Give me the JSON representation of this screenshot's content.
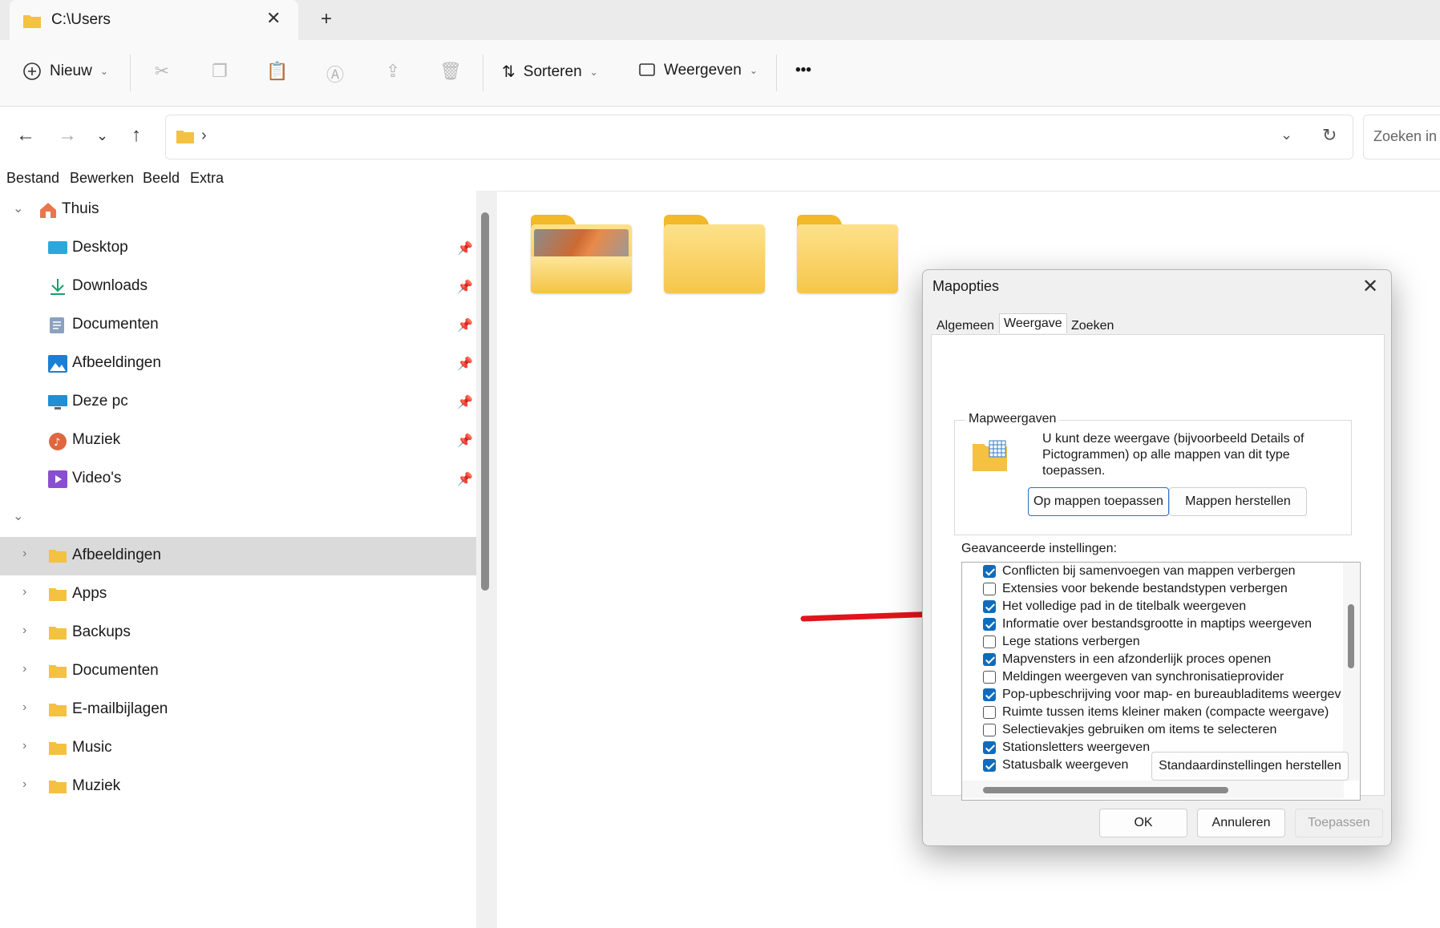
{
  "window": {
    "tab_title": "C:\\Users",
    "tab_close": "✕",
    "new_tab": "+"
  },
  "toolbar": {
    "new_label": "Nieuw",
    "sort_label": "Sorteren",
    "view_label": "Weergeven",
    "more_label": "•••"
  },
  "nav": {
    "search_placeholder": "Zoeken in A",
    "address_sep": "›"
  },
  "menu": [
    "Bestand",
    "Bewerken",
    "Beeld",
    "Extra"
  ],
  "sidebar": {
    "home": "Thuis",
    "quick": [
      "Desktop",
      "Downloads",
      "Documenten",
      "Afbeeldingen",
      "Deze pc",
      "Muziek",
      "Video's"
    ],
    "folders": [
      "Afbeeldingen",
      "Apps",
      "Backups",
      "Documenten",
      "E-mailbijlagen",
      "Music",
      "Muziek"
    ]
  },
  "dialog": {
    "title": "Mapopties",
    "tabs": [
      "Algemeen",
      "Weergave",
      "Zoeken"
    ],
    "active_tab": "Weergave",
    "group_label": "Mapweergaven",
    "group_desc": "U kunt deze weergave (bijvoorbeeld Details of Pictogrammen) op alle mappen van dit type toepassen.",
    "apply_btn": "Op mappen toepassen",
    "reset_btn": "Mappen herstellen",
    "advanced_label": "Geavanceerde instellingen:",
    "options": [
      {
        "label": "Conflicten bij samenvoegen van mappen verbergen",
        "checked": true
      },
      {
        "label": "Extensies voor bekende bestandstypen verbergen",
        "checked": false
      },
      {
        "label": "Het volledige pad in de titelbalk weergeven",
        "checked": true
      },
      {
        "label": "Informatie over bestandsgrootte in maptips weergeven",
        "checked": true
      },
      {
        "label": "Lege stations verbergen",
        "checked": false
      },
      {
        "label": "Mapvensters in een afzonderlijk proces openen",
        "checked": true
      },
      {
        "label": "Meldingen weergeven van synchronisatieprovider",
        "checked": false
      },
      {
        "label": "Pop-upbeschrijving voor map- en bureaubladitems weergev",
        "checked": true
      },
      {
        "label": "Ruimte tussen items kleiner maken (compacte weergave)",
        "checked": false
      },
      {
        "label": "Selectievakjes gebruiken om items te selecteren",
        "checked": false
      },
      {
        "label": "Stationsletters weergeven",
        "checked": true
      },
      {
        "label": "Statusbalk weergeven",
        "checked": true
      }
    ],
    "restore_defaults": "Standaardinstellingen herstellen",
    "ok": "OK",
    "cancel": "Annuleren",
    "apply": "Toepassen"
  },
  "colors": {
    "accent": "#0f6cbd",
    "arrow": "#e0141b",
    "folder": "#f6c64a"
  }
}
